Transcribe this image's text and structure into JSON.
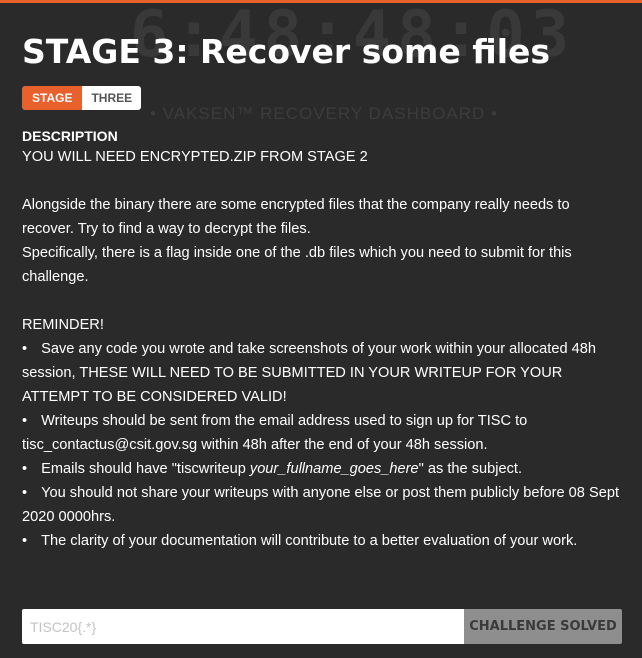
{
  "background": {
    "timer": "6:48:48:03",
    "dashboard": "• VAKSEN™ RECOVERY DASHBOARD •"
  },
  "challenge": {
    "title": "STAGE 3: Recover some files",
    "badge": {
      "label": "STAGE",
      "value": "THREE"
    },
    "description_heading": "DESCRIPTION",
    "requirement": "YOU WILL NEED ENCRYPTED.ZIP FROM STAGE 2",
    "paragraph_1": "Alongside the binary there are some encrypted files that the company really needs to recover. Try to find a way to decrypt the files.",
    "paragraph_2": "Specifically, there is a flag inside one of the .db files which you need to submit for this challenge.",
    "reminder_heading": "REMINDER!",
    "bullets": [
      {
        "text": "Save any code you wrote and take screenshots of your work within your allocated 48h session, THESE WILL NEED TO BE SUBMITTED IN YOUR WRITEUP FOR YOUR ATTEMPT TO BE CONSIDERED VALID!"
      },
      {
        "text": "Writeups should be sent from the email address used to sign up for TISC to tisc_contactus@csit.gov.sg within 48h after the end of your 48h session."
      },
      {
        "before": "Emails should have \"tiscwriteup ",
        "emphasis": "your_fullname_goes_here",
        "after": "\" as the subject."
      },
      {
        "text": "You should not share your writeups with anyone else or post them publicly before 08 Sept 2020 0000hrs."
      },
      {
        "text": "The clarity of your documentation will contribute to a better evaluation of your work."
      }
    ]
  },
  "flag_form": {
    "placeholder": "TISC20{.*}",
    "value": "",
    "button_label": "CHALLENGE SOLVED"
  },
  "colors": {
    "accent": "#e8602c",
    "background": "#2a2a2a",
    "button_disabled": "#8e8e8e"
  }
}
